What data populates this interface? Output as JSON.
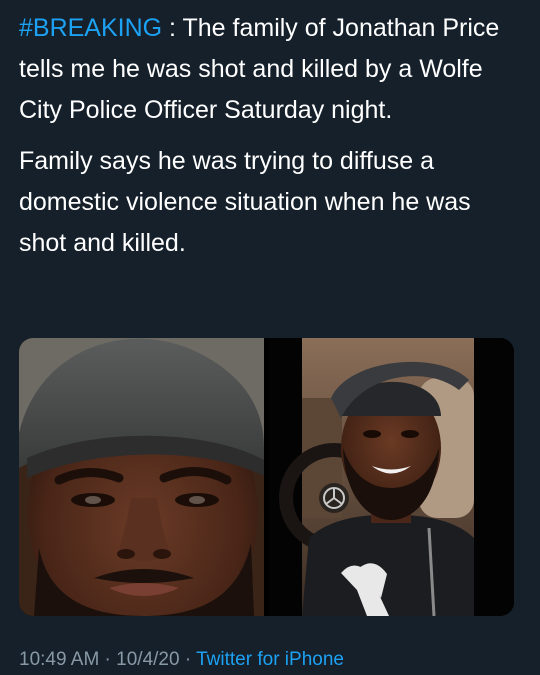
{
  "tweet": {
    "hashtag": "#BREAKING",
    "para1_text": " : The family of Jonathan Price tells me he was shot and killed by a Wolfe City Police Officer Saturday night.",
    "para2_text": "Family says he was trying to diffuse a domestic violence situation when he was shot and killed."
  },
  "media": {
    "photos": [
      {
        "icon": "portrait-photo-closeup"
      },
      {
        "icon": "portrait-photo-car-selfie"
      }
    ]
  },
  "meta": {
    "time": "10:49 AM",
    "separator_1": " · ",
    "date": "10/4/20",
    "separator_2": " · ",
    "source": "Twitter for iPhone"
  },
  "colors": {
    "background": "#15202b",
    "text": "#ffffff",
    "link": "#1da1f2",
    "muted": "#8899a6"
  }
}
